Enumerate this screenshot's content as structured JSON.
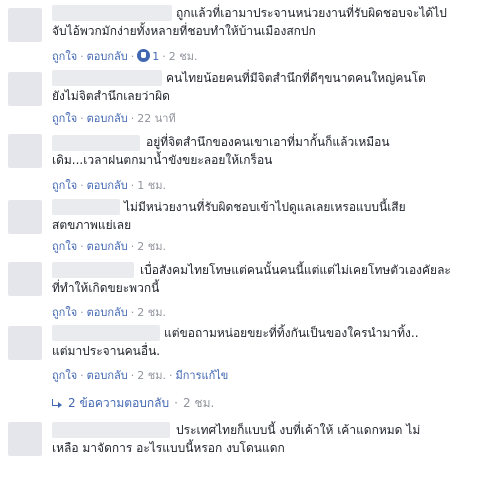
{
  "comments": [
    {
      "text": "ถูกแล้วที่เอามาประจานหน่วยงานที่รับผิดชอบจะได้ไป\nจับไอ้พวกมักง่ายทั้งหลายที่ชอบทำให้บ้านเมืองสกปก",
      "like": "ถูกใจ",
      "reply": "ตอบกลับ",
      "likes": "1",
      "time": "2 ชม.",
      "edited": ""
    },
    {
      "text": "คนไทยน้อยคนที่มีจิตสำนึกที่ดีๆขนาดคนใหญ่คนโต\nยังไม่จิตสำนึกเลยว่าผิด",
      "like": "ถูกใจ",
      "reply": "ตอบกลับ",
      "likes": "",
      "time": "22 นาที",
      "edited": ""
    },
    {
      "text": "อยู่ที่จิตสำนึกของคนเขาเอาที่มากั้นก็แล้วเหมือน\nเดิม...เวลาฝนตกมาน้ำขังขยะลอยให้เกร็อน",
      "like": "ถูกใจ",
      "reply": "ตอบกลับ",
      "likes": "",
      "time": "1 ชม.",
      "edited": ""
    },
    {
      "text": "ไม่มีหน่วยงานที่รับผิดชอบเข้าไปดูแลเลยเหรอแบบนี้เสีย\nสตขภาพแย่เลย",
      "like": "ถูกใจ",
      "reply": "ตอบกลับ",
      "likes": "",
      "time": "2 ชม.",
      "edited": ""
    },
    {
      "text": "เบื่อสังคมไทยโทษแต่คนนั้นคนนี้แต่แต่ไม่เคยโทษตัวเองคัยละ\nที่ทำให้เกิดขยะพวกนี้",
      "like": "ถูกใจ",
      "reply": "ตอบกลับ",
      "likes": "",
      "time": "2 ชม.",
      "edited": ""
    },
    {
      "text": "แต่ขอถามหน่อยขยะที่ทิ้งกันเป็นของใครนำมาทิ้ง..\nแต่มาประจานคนอื่น.",
      "like": "ถูกใจ",
      "reply": "ตอบกลับ",
      "likes": "",
      "time": "2 ชม.",
      "edited": "มีการแก้ไข"
    },
    {
      "text": "ประเทศไทยก็แบบนี้ งบที่เค้าให้ เค้าแดกหมด ไม่\nเหลือ มาจัดการ อะไรแบบนี้หรอก งบโดนแดก",
      "like": "ถูกใจ",
      "reply": "ตอบกลับ",
      "likes": "",
      "time": "",
      "edited": ""
    }
  ],
  "replies_link": {
    "label": "2 ข้อความตอบกลับ",
    "time": "2 ชม."
  },
  "colors": {
    "link": "#4267b2",
    "meta": "#90949c",
    "text": "#1d2129"
  }
}
